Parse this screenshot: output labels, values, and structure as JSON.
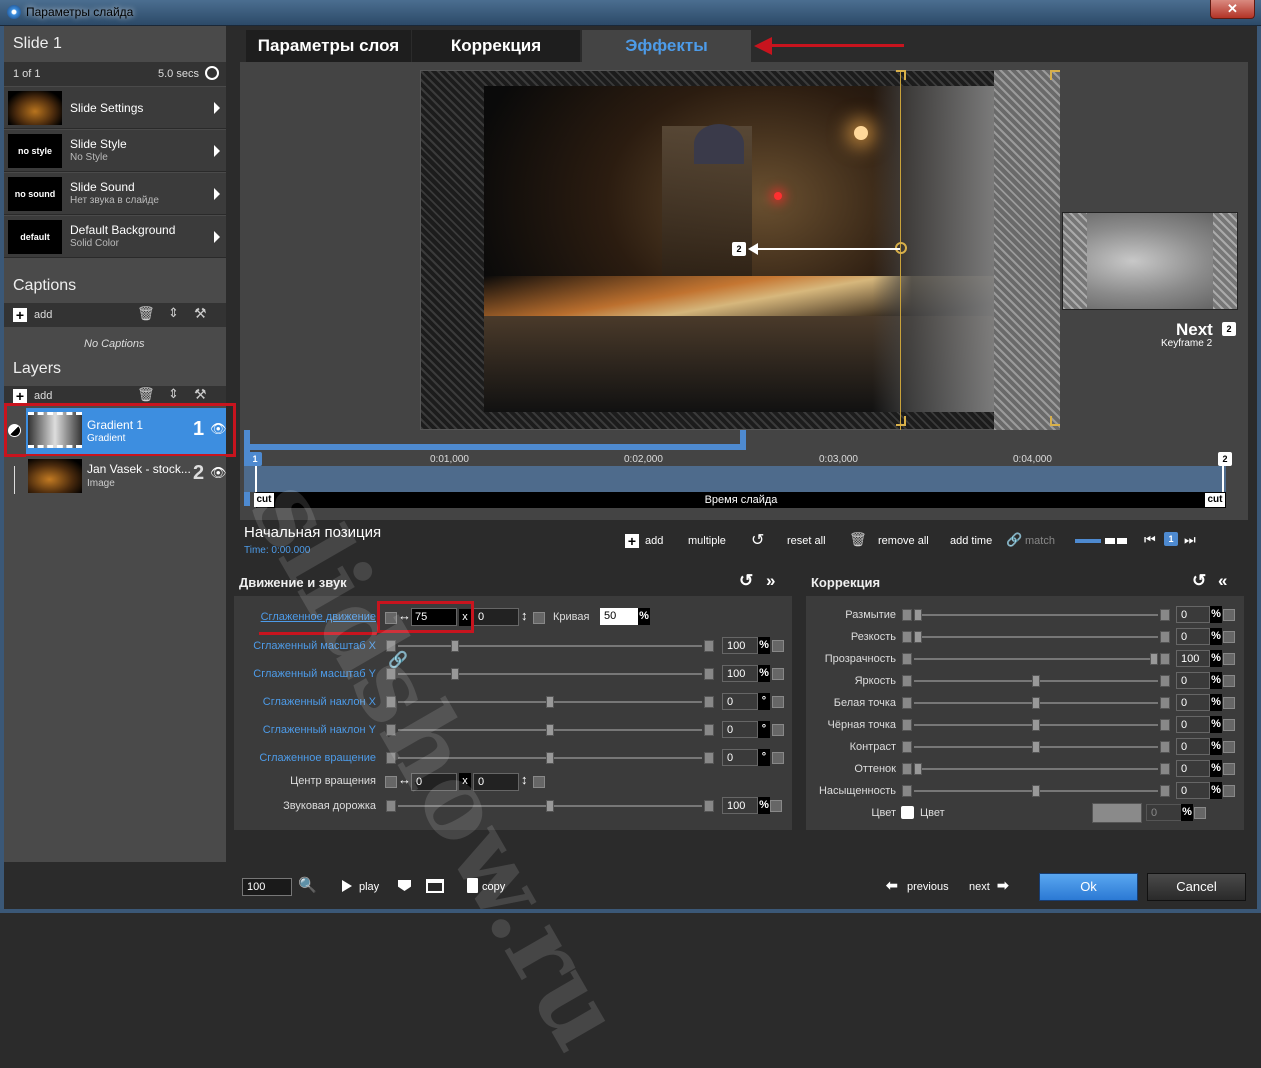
{
  "window": {
    "title": "Параметры слайда",
    "close_glyph": "✕"
  },
  "left": {
    "slide_title": "Slide 1",
    "slide_counter": "1 of 1",
    "slide_duration": "5.0 secs",
    "settings_rows": [
      {
        "thumb_text": "",
        "title": "Slide Settings",
        "subtitle": ""
      },
      {
        "thumb_text": "no style",
        "title": "Slide Style",
        "subtitle": "No Style"
      },
      {
        "thumb_text": "no sound",
        "title": "Slide Sound",
        "subtitle": "Нет звука в слайде"
      },
      {
        "thumb_text": "default",
        "title": "Default Background",
        "subtitle": "Solid Color"
      }
    ],
    "captions_title": "Captions",
    "captions_add": "add",
    "captions_empty": "No Captions",
    "layers_title": "Layers",
    "layers_add": "add",
    "layers": [
      {
        "name": "Gradient 1",
        "type": "Gradient",
        "number": "1",
        "selected": true
      },
      {
        "name": "Jan Vasek - stock...",
        "type": "Image",
        "number": "2",
        "selected": false
      }
    ]
  },
  "tabs": [
    {
      "label": "Параметры слоя",
      "active": false
    },
    {
      "label": "Коррекция",
      "active": false
    },
    {
      "label": "Эффекты",
      "active": true
    }
  ],
  "preview": {
    "next_label": "Next",
    "next_badge": "2",
    "next_sub": "Keyframe 2",
    "motion_badge": "2"
  },
  "timeline": {
    "ticks": [
      "0:01,000",
      "0:02,000",
      "0:03,000",
      "0:04,000"
    ],
    "start_marker": "1",
    "end_marker": "2",
    "cut_label": "cut",
    "slide_time_label": "Время слайда"
  },
  "keyframe": {
    "title": "Начальная позиция",
    "time": "Time: 0:00.000",
    "add": "add",
    "multiple": "multiple",
    "reset_all": "reset all",
    "remove_all": "remove all",
    "add_time": "add time",
    "match": "match",
    "current_kf": "1"
  },
  "motion_panel": {
    "title": "Движение и звук",
    "smooth_motion_label": "Сглаженное движение",
    "smooth_motion_x": "75",
    "smooth_motion_y": "0",
    "x_sep": "x",
    "curve_label": "Кривая",
    "curve_value": "50",
    "rows": [
      {
        "label": "Сглаженный масштаб X",
        "value": "100",
        "unit": "%",
        "level": 0.18,
        "blue": true
      },
      {
        "label": "Сглаженный масштаб Y",
        "value": "100",
        "unit": "%",
        "level": 0.18,
        "blue": true
      },
      {
        "label": "Сглаженный наклон X",
        "value": "0",
        "unit": "°",
        "level": 0.5,
        "blue": true
      },
      {
        "label": "Сглаженный наклон Y",
        "value": "0",
        "unit": "°",
        "level": 0.5,
        "blue": true
      },
      {
        "label": "Сглаженное вращение",
        "value": "0",
        "unit": "°",
        "level": 0.5,
        "blue": true
      }
    ],
    "rot_center_label": "Центр вращения",
    "rot_center_x": "0",
    "rot_center_y": "0",
    "audio_label": "Звуковая дорожка",
    "audio_value": "100",
    "audio_unit": "%",
    "audio_level": 0.5
  },
  "correction_panel": {
    "title": "Коррекция",
    "rows": [
      {
        "label": "Размытие",
        "value": "0",
        "level": 0.0
      },
      {
        "label": "Резкость",
        "value": "0",
        "level": 0.0
      },
      {
        "label": "Прозрачность",
        "value": "100",
        "level": 1.0
      },
      {
        "label": "Яркость",
        "value": "0",
        "level": 0.5
      },
      {
        "label": "Белая точка",
        "value": "0",
        "level": 0.5
      },
      {
        "label": "Чёрная точка",
        "value": "0",
        "level": 0.5
      },
      {
        "label": "Контраст",
        "value": "0",
        "level": 0.5
      },
      {
        "label": "Оттенок",
        "value": "0",
        "level": 0.0
      },
      {
        "label": "Насыщенность",
        "value": "0",
        "level": 0.5
      }
    ],
    "unit": "%",
    "color_label": "Цвет",
    "color_checkbox_label": "Цвет",
    "color_value": "0"
  },
  "bottom": {
    "zoom": "100",
    "play": "play",
    "copy": "copy",
    "previous": "previous",
    "next": "next",
    "ok": "Ok",
    "cancel": "Cancel"
  },
  "watermark": "slidshow.ru",
  "colors": {
    "accent": "#4d9be8",
    "highlight_red": "#c8141e",
    "selected_layer": "#3d8ee0"
  }
}
